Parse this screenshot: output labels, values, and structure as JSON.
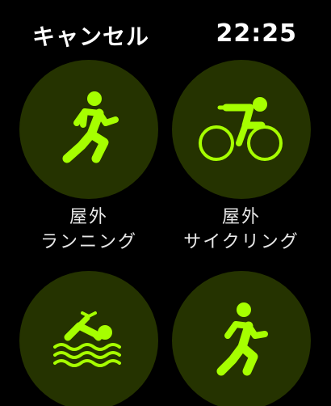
{
  "header": {
    "cancel_label": "キャンセル",
    "time": "22:25"
  },
  "colors": {
    "background": "#000000",
    "tile_background": "#253300",
    "icon_accent": "#a6ff00",
    "text": "#ffffff"
  },
  "workouts": [
    {
      "icon": "running-icon",
      "line1": "屋外",
      "line2": "ランニング"
    },
    {
      "icon": "cycling-icon",
      "line1": "屋外",
      "line2": "サイクリング"
    },
    {
      "icon": "swimming-icon",
      "line1": "",
      "line2": ""
    },
    {
      "icon": "walking-icon",
      "line1": "",
      "line2": ""
    }
  ]
}
